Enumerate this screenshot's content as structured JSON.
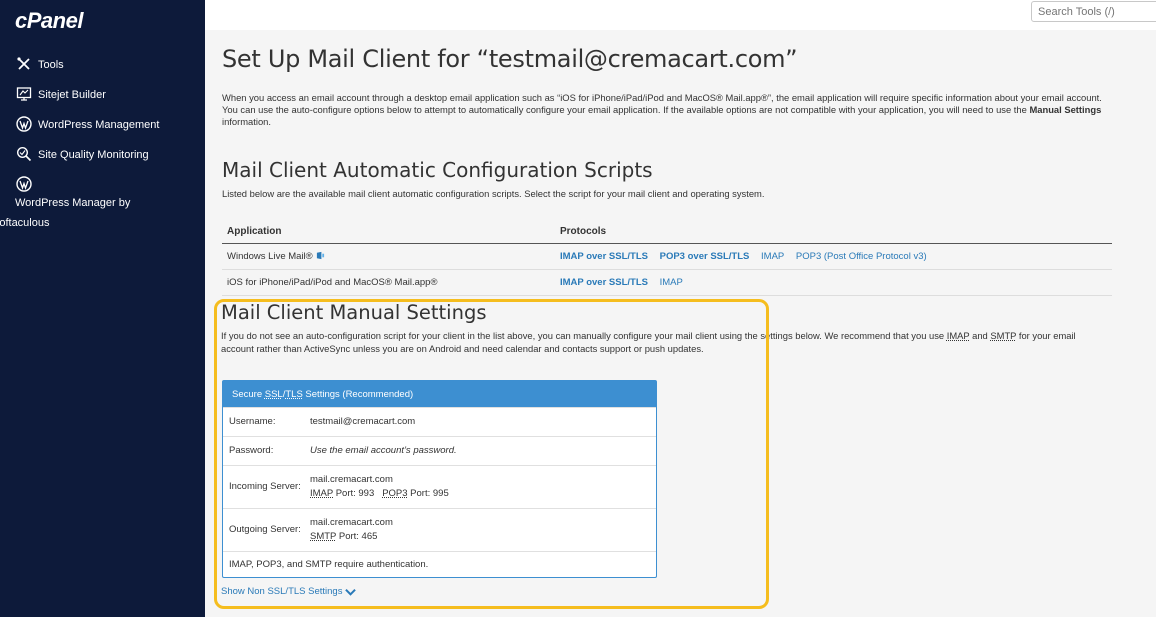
{
  "brand": {
    "logo": "cPanel"
  },
  "sidebar": {
    "items": [
      {
        "label": "Tools",
        "icon": "tools-icon"
      },
      {
        "label": "Sitejet Builder",
        "icon": "sitejet-icon"
      },
      {
        "label": "WordPress Management",
        "icon": "wordpress-icon"
      },
      {
        "label": "Site Quality Monitoring",
        "icon": "site-quality-icon"
      },
      {
        "label": "WordPress Manager by Softaculous",
        "icon": "wordpress-icon"
      }
    ]
  },
  "search": {
    "placeholder": "Search Tools (/)"
  },
  "page": {
    "title": "Set Up Mail Client for “testmail@cremacart.com”",
    "intro_part1": "When you access an email account through a desktop email application such as “iOS for iPhone/iPad/iPod and MacOS® Mail.app®”, the email application will require specific information about your email account. You can use the auto-configure options below to attempt to automatically configure your email application. If the available options are not compatible with your application, you will need to use the ",
    "intro_bold": "Manual Settings",
    "intro_part2": " information."
  },
  "auto": {
    "heading": "Mail Client Automatic Configuration Scripts",
    "description": "Listed below are the available mail client automatic configuration scripts. Select the script for your mail client and operating system.",
    "col_application": "Application",
    "col_protocols": "Protocols",
    "rows": [
      {
        "app": "Windows Live Mail®",
        "protocols": [
          {
            "label": "IMAP over SSL/TLS",
            "bold": true
          },
          {
            "label": "POP3 over SSL/TLS",
            "bold": true
          },
          {
            "label": "IMAP",
            "bold": false
          },
          {
            "label": "POP3 (Post Office Protocol v3)",
            "bold": false
          }
        ]
      },
      {
        "app": "iOS for iPhone/iPad/iPod and MacOS® Mail.app®",
        "protocols": [
          {
            "label": "IMAP over SSL/TLS",
            "bold": true
          },
          {
            "label": "IMAP",
            "bold": false
          }
        ]
      }
    ]
  },
  "manual": {
    "heading": "Mail Client Manual Settings",
    "desc_part1": "If you do not see an auto-configuration script for your client in the list above, you can manually configure your mail client using the settings below. We recommend that you use ",
    "desc_imap": "IMAP",
    "desc_and": " and ",
    "desc_smtp": "SMTP",
    "desc_part2": " for your email account rather than ActiveSync unless you are on Android and need calendar and contacts support or push updates.",
    "panel": {
      "title_prefix": "Secure ",
      "title_ssl": "SSL",
      "title_slash": "/",
      "title_tls": "TLS",
      "title_suffix": " Settings (Recommended)",
      "username_label": "Username:",
      "username": "testmail@cremacart.com",
      "password_label": "Password:",
      "password": "Use the email account’s password.",
      "incoming_label": "Incoming Server:",
      "incoming_host": "mail.cremacart.com",
      "imap_abbr": "IMAP",
      "imap_port_text": " Port: 993",
      "pop3_abbr": "POP3",
      "pop3_port_text": " Port: 995",
      "outgoing_label": "Outgoing Server:",
      "outgoing_host": "mail.cremacart.com",
      "smtp_abbr": "SMTP",
      "smtp_port_text": " Port: 465",
      "auth_note": "IMAP, POP3, and SMTP require authentication."
    },
    "show_non_ssl": "Show Non SSL/TLS Settings"
  },
  "colors": {
    "sidebar_bg": "#0d1a3a",
    "link": "#2a7ab8",
    "panel_blue": "#3d8fd1",
    "highlight": "#f5bd1e"
  }
}
